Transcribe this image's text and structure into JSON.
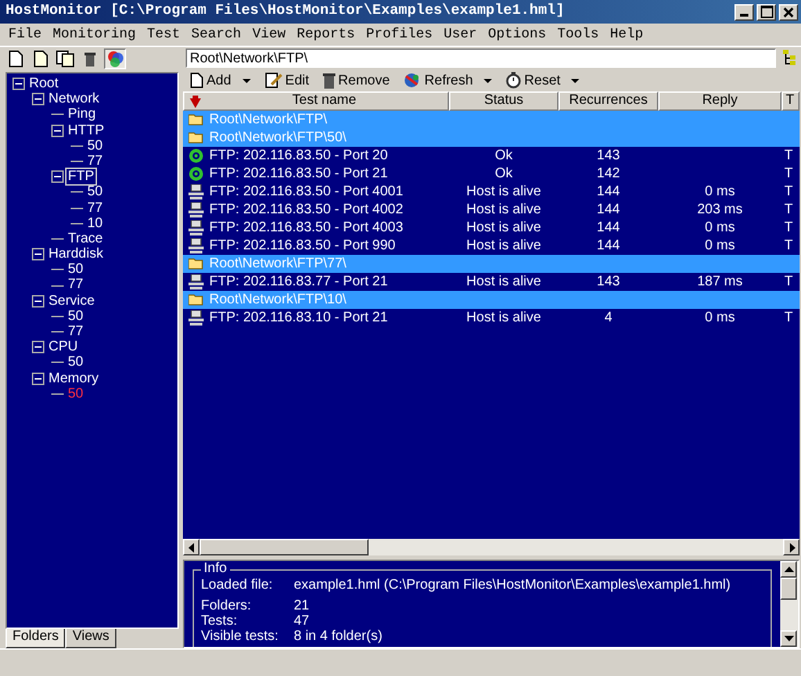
{
  "window": {
    "title": "HostMonitor  [C:\\Program Files\\HostMonitor\\Examples\\example1.hml]"
  },
  "menu": [
    "File",
    "Monitoring",
    "Test",
    "Search",
    "View",
    "Reports",
    "Profiles",
    "User",
    "Options",
    "Tools",
    "Help"
  ],
  "path_field": {
    "value": "Root\\Network\\FTP\\"
  },
  "tree": [
    {
      "label": "Root",
      "selected": false,
      "alert": false,
      "children": [
        {
          "label": "Network",
          "selected": false,
          "alert": false,
          "children": [
            {
              "label": "Ping",
              "selected": false,
              "alert": false
            },
            {
              "label": "HTTP",
              "selected": false,
              "alert": false,
              "children": [
                {
                  "label": "50",
                  "selected": false,
                  "alert": false
                },
                {
                  "label": "77",
                  "selected": false,
                  "alert": false
                }
              ]
            },
            {
              "label": "FTP",
              "selected": true,
              "alert": false,
              "children": [
                {
                  "label": "50",
                  "selected": false,
                  "alert": false
                },
                {
                  "label": "77",
                  "selected": false,
                  "alert": false
                },
                {
                  "label": "10",
                  "selected": false,
                  "alert": false
                }
              ]
            },
            {
              "label": "Trace",
              "selected": false,
              "alert": false
            }
          ]
        },
        {
          "label": "Harddisk",
          "selected": false,
          "alert": false,
          "children": [
            {
              "label": "50",
              "selected": false,
              "alert": false
            },
            {
              "label": "77",
              "selected": false,
              "alert": false
            }
          ]
        },
        {
          "label": "Service",
          "selected": false,
          "alert": false,
          "children": [
            {
              "label": "50",
              "selected": false,
              "alert": false
            },
            {
              "label": "77",
              "selected": false,
              "alert": false
            }
          ]
        },
        {
          "label": "CPU",
          "selected": false,
          "alert": false,
          "children": [
            {
              "label": "50",
              "selected": false,
              "alert": false
            }
          ]
        },
        {
          "label": "Memory",
          "selected": false,
          "alert": false,
          "children": [
            {
              "label": "50",
              "selected": false,
              "alert": true
            }
          ]
        }
      ]
    }
  ],
  "left_tabs": [
    {
      "label": "Folders",
      "selected": true
    },
    {
      "label": "Views",
      "selected": false
    }
  ],
  "toolbar": [
    {
      "label": "Add",
      "kind": "add",
      "dropdown": true
    },
    {
      "label": "Edit",
      "kind": "edit",
      "dropdown": false
    },
    {
      "label": "Remove",
      "kind": "remove",
      "dropdown": false
    },
    {
      "label": "Refresh",
      "kind": "refresh",
      "dropdown": true
    },
    {
      "label": "Reset",
      "kind": "reset",
      "dropdown": true
    }
  ],
  "table": {
    "columns": [
      "Test name",
      "Status",
      "Recurrences",
      "Reply",
      "T"
    ],
    "rows": [
      {
        "kind": "folder",
        "name": "Root\\Network\\FTP\\"
      },
      {
        "kind": "folder",
        "name": "Root\\Network\\FTP\\50\\"
      },
      {
        "kind": "ok",
        "name": "FTP: 202.116.83.50 - Port 20",
        "status": "Ok",
        "recurrences": "143",
        "reply": "",
        "column_5": "T"
      },
      {
        "kind": "ok",
        "name": "FTP: 202.116.83.50 - Port 21",
        "status": "Ok",
        "recurrences": "142",
        "reply": "",
        "column_5": "T"
      },
      {
        "kind": "alive",
        "name": "FTP: 202.116.83.50 - Port 4001",
        "status": "Host is alive",
        "recurrences": "144",
        "reply": "0 ms",
        "column_5": "T"
      },
      {
        "kind": "alive",
        "name": "FTP: 202.116.83.50 - Port 4002",
        "status": "Host is alive",
        "recurrences": "144",
        "reply": "203 ms",
        "column_5": "T"
      },
      {
        "kind": "alive",
        "name": "FTP: 202.116.83.50 - Port 4003",
        "status": "Host is alive",
        "recurrences": "144",
        "reply": "0 ms",
        "column_5": "T"
      },
      {
        "kind": "alive",
        "name": "FTP: 202.116.83.50 - Port 990",
        "status": "Host is alive",
        "recurrences": "144",
        "reply": "0 ms",
        "column_5": "T"
      },
      {
        "kind": "folder",
        "name": "Root\\Network\\FTP\\77\\"
      },
      {
        "kind": "alive",
        "name": "FTP: 202.116.83.77 - Port 21",
        "status": "Host is alive",
        "recurrences": "143",
        "reply": "187 ms",
        "column_5": "T"
      },
      {
        "kind": "folder",
        "name": "Root\\Network\\FTP\\10\\"
      },
      {
        "kind": "alive",
        "name": "FTP: 202.116.83.10 - Port 21",
        "status": "Host is alive",
        "recurrences": "4",
        "reply": "0 ms",
        "column_5": "T"
      }
    ]
  },
  "info": {
    "title": "Info",
    "rows": [
      {
        "label": "Loaded file:",
        "value": "example1.hml  (C:\\Program Files\\HostMonitor\\Examples\\example1.hml)"
      },
      {
        "label": "Folders:",
        "value": "21"
      },
      {
        "label": "Tests:",
        "value": "47"
      },
      {
        "label": "Visible tests:",
        "value": "8 in 4 folder(s)"
      }
    ]
  }
}
